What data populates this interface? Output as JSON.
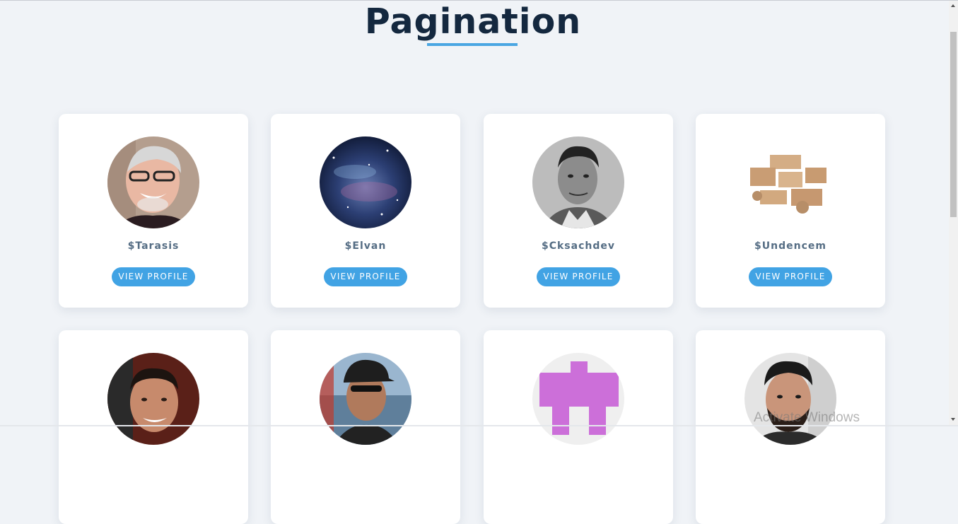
{
  "page": {
    "title": "Pagination"
  },
  "users": [
    {
      "name": "$Tarasis",
      "button": "VIEW PROFILE",
      "avatar": "avatar-smiling-man-glasses"
    },
    {
      "name": "$Elvan",
      "button": "VIEW PROFILE",
      "avatar": "avatar-galaxy"
    },
    {
      "name": "$Cksachdev",
      "button": "VIEW PROFILE",
      "avatar": "avatar-man-grayscale"
    },
    {
      "name": "$Undencem",
      "button": "VIEW PROFILE",
      "avatar": "avatar-cardboard-boxes"
    },
    {
      "avatar": "avatar-smiling-man"
    },
    {
      "avatar": "avatar-man-cap-sunglasses"
    },
    {
      "avatar": "avatar-pixel-invader"
    },
    {
      "avatar": "avatar-bearded-man"
    }
  ],
  "overlay": {
    "watermark": "Activate Windows"
  },
  "colors": {
    "accent": "#41a3e4",
    "title": "#14283f",
    "name": "#556d84",
    "background": "#f0f3f7"
  }
}
